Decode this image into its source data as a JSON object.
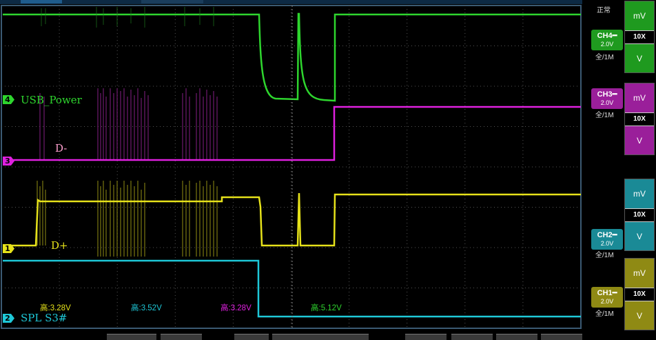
{
  "status": "正常",
  "channels": [
    {
      "id": "ch4",
      "number": "4",
      "label": "USB_Power",
      "color": "#2ed62e",
      "box_label": "CH4",
      "volt_div": "2.0V",
      "coupling": "全/1M",
      "unit_top": "mV",
      "probe": "10X",
      "unit_bottom": "V",
      "measure": "高:5.12V"
    },
    {
      "id": "ch3",
      "number": "3",
      "label": "D-",
      "color": "#e020e0",
      "box_label": "CH3",
      "volt_div": "2.0V",
      "coupling": "全/1M",
      "unit_top": "mV",
      "probe": "10X",
      "unit_bottom": "V",
      "measure": "高:3.28V"
    },
    {
      "id": "ch2",
      "number": "2",
      "label": "SPL S3#",
      "color": "#1ec8d8",
      "box_label": "CH2",
      "volt_div": "2.0V",
      "coupling": "全/1M",
      "unit_top": "mV",
      "probe": "10X",
      "unit_bottom": "V",
      "measure": "高:3.52V"
    },
    {
      "id": "ch1",
      "number": "1",
      "label": "D+",
      "color": "#e6e21a",
      "box_label": "CH1",
      "volt_div": "2.0V",
      "coupling": "全/1M",
      "unit_top": "mV",
      "probe": "10X",
      "unit_bottom": "V",
      "measure": "高:3.28V"
    }
  ]
}
